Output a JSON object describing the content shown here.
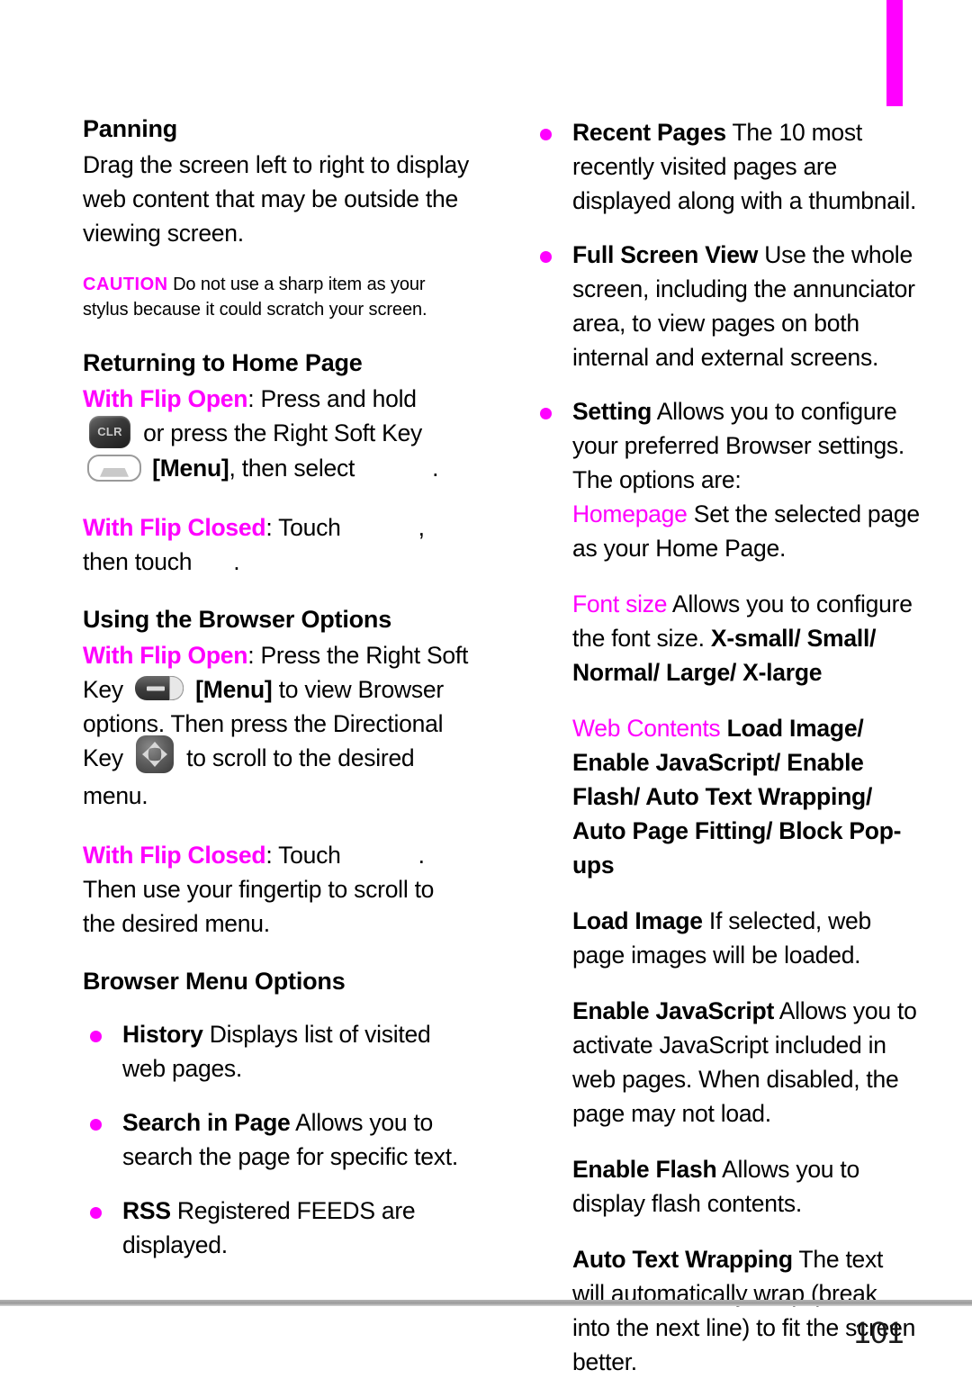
{
  "page": {
    "number": "101",
    "accent_color": "#ff00ff",
    "rule_color": "#9a9a9a",
    "tab_marker_color": "#ff00ff"
  },
  "left_column": {
    "panning": {
      "heading": "Panning",
      "body": "Drag the screen left to right to display web content that may be outside the viewing screen."
    },
    "caution": {
      "label": "CAUTION",
      "text": "Do not use a sharp item as your stylus because it could scratch your screen."
    },
    "returning_home": {
      "heading": "Returning to Home Page",
      "flip_open_label": "With Flip Open",
      "flip_open_part1": ": Press and hold",
      "flip_open_part2": "or press the Right Soft Key",
      "flip_open_menu": "[Menu]",
      "flip_open_part3": ", then select",
      "flip_open_end": ".",
      "flip_closed_label": "With Flip Closed",
      "flip_closed_part1": ": Touch",
      "flip_closed_part2": ", then touch",
      "flip_closed_end": "."
    },
    "browser_options": {
      "heading": "Using the Browser Options",
      "flip_open_label": "With Flip Open",
      "flip_open_part1": ": Press the Right Soft Key",
      "flip_open_menu": "[Menu]",
      "flip_open_part2": "to view Browser options. Then press the Directional Key",
      "flip_open_part3": "to scroll to the desired menu.",
      "flip_closed_label": "With Flip Closed",
      "flip_closed_part1": ": Touch",
      "flip_closed_part2": ". Then use your fingertip to scroll to the desired menu."
    },
    "menu_options": {
      "heading": "Browser Menu Options",
      "items": [
        {
          "term": "History",
          "desc": "Displays list of visited web pages."
        },
        {
          "term": "Search in Page",
          "desc": "Allows you to search the page for specific text."
        },
        {
          "term": "RSS",
          "desc": "Registered FEEDS are displayed."
        }
      ]
    }
  },
  "right_column": {
    "items": [
      {
        "term": "Recent Pages",
        "desc": "The 10 most recently visited pages are displayed along with a thumbnail."
      },
      {
        "term": "Full Screen View",
        "desc": "Use the whole screen, including the annunciator area, to view pages on both internal and external screens."
      },
      {
        "term": "Setting",
        "desc": "Allows you to configure your preferred Browser settings. The options are:"
      }
    ],
    "settings": {
      "homepage": {
        "term": "Homepage",
        "desc": "Set the selected page as your Home Page."
      },
      "font_size": {
        "term": "Font size",
        "desc": "Allows you to configure the font size.",
        "values": "X-small/ Small/ Normal/ Large/ X-large"
      },
      "web_contents": {
        "term": "Web Contents",
        "values": "Load Image/ Enable JavaScript/ Enable Flash/ Auto Text Wrapping/ Auto Page Fitting/ Block Pop-ups"
      },
      "details": [
        {
          "term": "Load Image",
          "desc": "If selected, web page images will be loaded."
        },
        {
          "term": "Enable JavaScript",
          "desc": "Allows you to activate JavaScript included in web pages. When disabled, the page may not load."
        },
        {
          "term": "Enable Flash",
          "desc": "Allows you to display flash contents."
        },
        {
          "term": "Auto Text Wrapping",
          "desc": "The text will automatically wrap (break into the next line) to fit the screen better."
        }
      ]
    }
  },
  "icons": {
    "clr_key_label": "CLR"
  }
}
